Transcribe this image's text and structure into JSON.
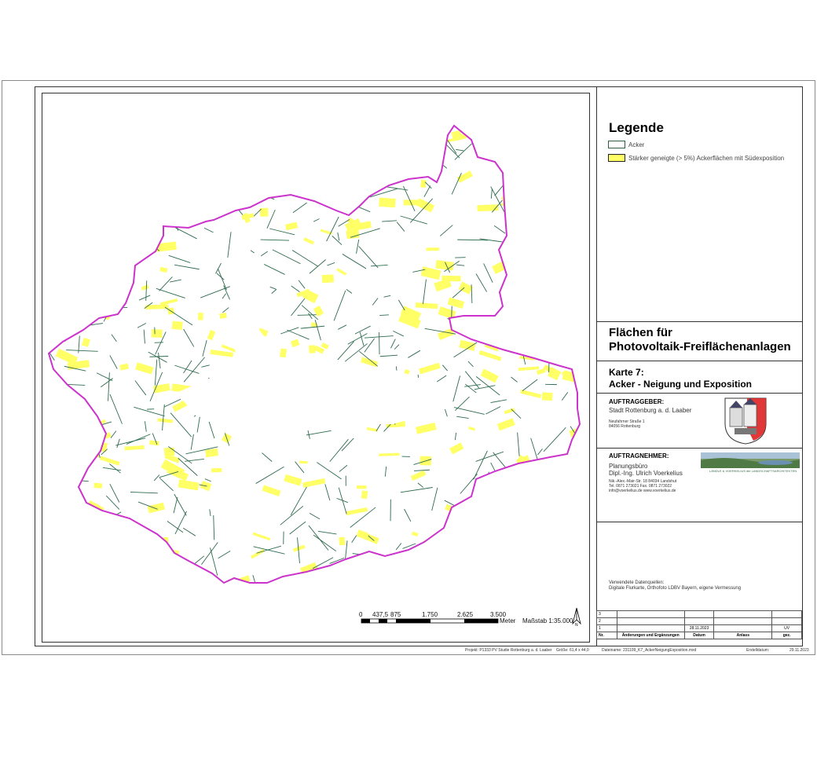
{
  "legend": {
    "title": "Legende",
    "items": [
      {
        "label": "Acker",
        "color": "#ffffff",
        "border": "#2e5d43"
      },
      {
        "label": "Stärker geneigte (> 5%) Ackerflächen mit Südexposition",
        "color": "#ffff66",
        "border": "#222222"
      }
    ]
  },
  "map": {
    "boundary_color": "#cc33cc",
    "field_line_color": "#2e6b4f",
    "highlight_color": "#ffff66"
  },
  "scalebar": {
    "ticks": [
      "0",
      "437,5",
      "875",
      "1.750",
      "2.625",
      "3.500"
    ],
    "unit": "Meter",
    "scale_label": "Maßstab 1:35.000",
    "north": "N"
  },
  "titleblock": {
    "title_line1": "Flächen für",
    "title_line2": "Photovoltaik-Freiflächenanlagen",
    "map_no": "Karte 7:",
    "map_name": "Acker - Neigung und Exposition",
    "client_label": "AUFTRAGGEBER:",
    "client_name": "Stadt Rottenburg a. d. Laaber",
    "client_addr1": "Neufahrner Straße 1",
    "client_addr2": "84056 Rottenburg",
    "contractor_label": "AUFTRAGNEHMER:",
    "contractor_line1": "Planungsbüro",
    "contractor_line2": "Dipl.-Ing. Ulrich Voerkelius",
    "contractor_addr1": "Nik.-Alex.-Mair-Str. 18  84034 Landshut",
    "contractor_addr2": "Tel. 0871 273021  Fax. 0871 273022",
    "contractor_addr3": "info@voerkelius.de    www.voerkelius.de",
    "logo_caption": "LÄNDLE & VOERKELIUS die LANDSCHAFTSARCHITEKTEN",
    "sources_label": "Verwendete Datenquellen:",
    "sources_text": "Digitale Flurkarte,  Orthofoto LDBV Bayern, eigene Vermessung"
  },
  "revisions": {
    "rows": [
      {
        "nr": "3",
        "desc": "",
        "date": "",
        "note": "",
        "sign": ""
      },
      {
        "nr": "2",
        "desc": "",
        "date": "",
        "note": "",
        "sign": ""
      },
      {
        "nr": "1",
        "desc": "",
        "date": "28.11.2023",
        "note": "",
        "sign": "UV"
      }
    ],
    "header": {
      "nr": "Nr.",
      "desc": "Änderungen und Ergänzungen",
      "date": "Datum",
      "note": "Anlass",
      "sign": "gez."
    }
  },
  "footer": {
    "project": "Projekt: P1333 PV Studie Rottenburg a. d. Laaber",
    "size": "Größe: 61,4 x 44,0",
    "file": "Dateiname: 231109_K7_AckerNeigungExposition.mxd",
    "created_label": "Erstelldatum:",
    "created_date": "29.11.2023"
  }
}
